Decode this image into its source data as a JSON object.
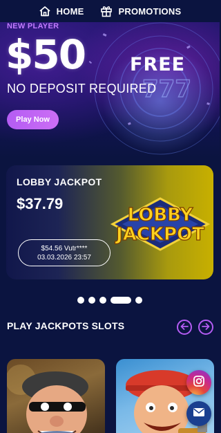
{
  "nav": {
    "items": [
      {
        "label": "HOME",
        "icon": "home-icon"
      },
      {
        "label": "PROMOTIONS",
        "icon": "gift-icon"
      }
    ]
  },
  "hero": {
    "badge": "NEW PLAYER",
    "amount": "$50",
    "free": "FREE",
    "subtitle": "NO DEPOSIT REQUIRED",
    "cta": "Play Now"
  },
  "jackpot": {
    "title": "LOBBY JACKPOT",
    "amount": "$37.79",
    "last_win_amount": "$54.56 Vutr****",
    "last_win_date": "03.03.2026 23:57",
    "logo_line1": "LOBBY",
    "logo_line2": "JACKPOT"
  },
  "carousel": {
    "dot_count": 5,
    "active_index": 3
  },
  "section": {
    "title": "PLAY JACKPOTS SLOTS"
  },
  "games": [
    {
      "name": "game-tile-robber"
    },
    {
      "name": "game-tile-plumber"
    }
  ],
  "social": {
    "instagram_icon": "instagram-icon",
    "mail_icon": "mail-icon"
  },
  "colors": {
    "background": "#0b1440",
    "accent": "#b45cf3",
    "badge": "#c27bff",
    "jackpot_gold": "#c8b000"
  }
}
